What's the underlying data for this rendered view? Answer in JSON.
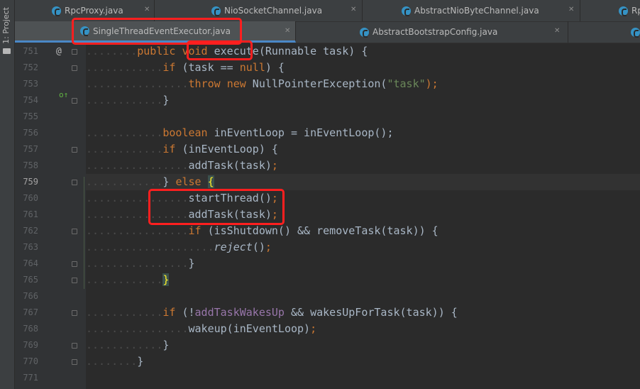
{
  "sidebar": {
    "label": "1: Project"
  },
  "tabs_row1": [
    {
      "label": "RpcProxy.java",
      "close": "✕"
    },
    {
      "label": "NioSocketChannel.java",
      "close": "✕"
    },
    {
      "label": "AbstractNioByteChannel.java",
      "close": "✕"
    },
    {
      "label": "Rp",
      "close": ""
    }
  ],
  "tabs_row2": [
    {
      "label": "SingleThreadEventExecutor.java",
      "close": "✕",
      "active": true
    },
    {
      "label": "AbstractBootstrapConfig.java",
      "close": "✕"
    },
    {
      "label": "",
      "close": ""
    }
  ],
  "gutter": {
    "override_marker": "o↑",
    "at_marker": "@",
    "line_numbers": [
      "751",
      "752",
      "753",
      "754",
      "755",
      "756",
      "757",
      "758",
      "759",
      "760",
      "761",
      "762",
      "763",
      "764",
      "765",
      "766",
      "767",
      "768",
      "769",
      "770",
      "771"
    ],
    "current_line": "759"
  },
  "code": {
    "l751": {
      "public": "public",
      "void": "void",
      "name": "execute",
      "rest": "(Runnable task) {"
    },
    "l752": {
      "if": "if",
      "p1": " (task == ",
      "null": "null",
      "p2": ") {"
    },
    "l753": {
      "throw": "throw",
      "new": "new",
      "cls": " NullPointerException(",
      "str": "\"task\"",
      "end": ");"
    },
    "l754": {
      "text": "}"
    },
    "l756": {
      "boolean": "boolean",
      "rest": " inEventLoop = inEventLoop();"
    },
    "l757": {
      "if": "if",
      "rest": " (inEventLoop) {"
    },
    "l758": {
      "call": "addTask(task)",
      "semi": ";"
    },
    "l759": {
      "close": "} ",
      "else": "else",
      "brace": "{"
    },
    "l760": {
      "call": "startThread()",
      "semi": ";"
    },
    "l761": {
      "call": "addTask(task)",
      "semi": ";"
    },
    "l762": {
      "if": "if",
      "rest": " (isShutdown() && removeTask(task)) {"
    },
    "l763": {
      "call": "reject",
      "args": "()",
      "semi": ";"
    },
    "l764": {
      "text": "}"
    },
    "l765": {
      "brace": "}"
    },
    "l767": {
      "if": "if",
      "p1": " (!",
      "field": "addTaskWakesUp",
      "p2": " && wakesUpForTask(task)) {"
    },
    "l768": {
      "call": "wakeup(inEventLoop)",
      "semi": ";"
    },
    "l769": {
      "text": "}"
    },
    "l770": {
      "text": "}"
    }
  },
  "dots": {
    "d1": "....",
    "d2": "........",
    "d3": "............",
    "d4": "................"
  },
  "colors": {
    "keyword": "#cc7832",
    "string": "#6a8759",
    "field": "#9876aa",
    "text": "#a9b7c6",
    "highlight_box": "#ff1f1f",
    "background": "#2b2b2b"
  }
}
